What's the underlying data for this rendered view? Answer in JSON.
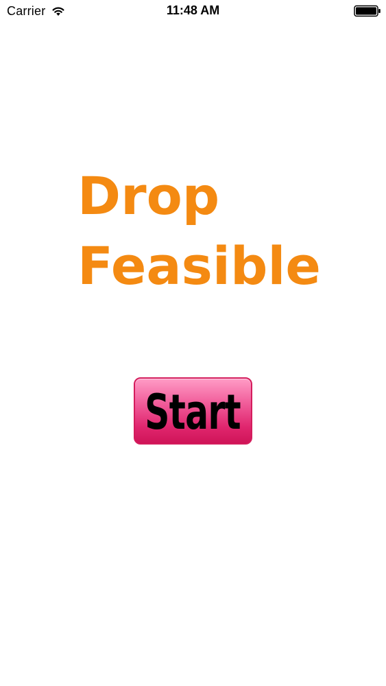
{
  "status_bar": {
    "carrier": "Carrier",
    "time": "11:48 AM",
    "icons": [
      "wifi-icon",
      "battery-icon"
    ]
  },
  "title": {
    "line1": "Drop",
    "line2": "Feasible",
    "color": "#f48a12"
  },
  "start_button": {
    "label": "Start",
    "color": "#e0266e"
  }
}
